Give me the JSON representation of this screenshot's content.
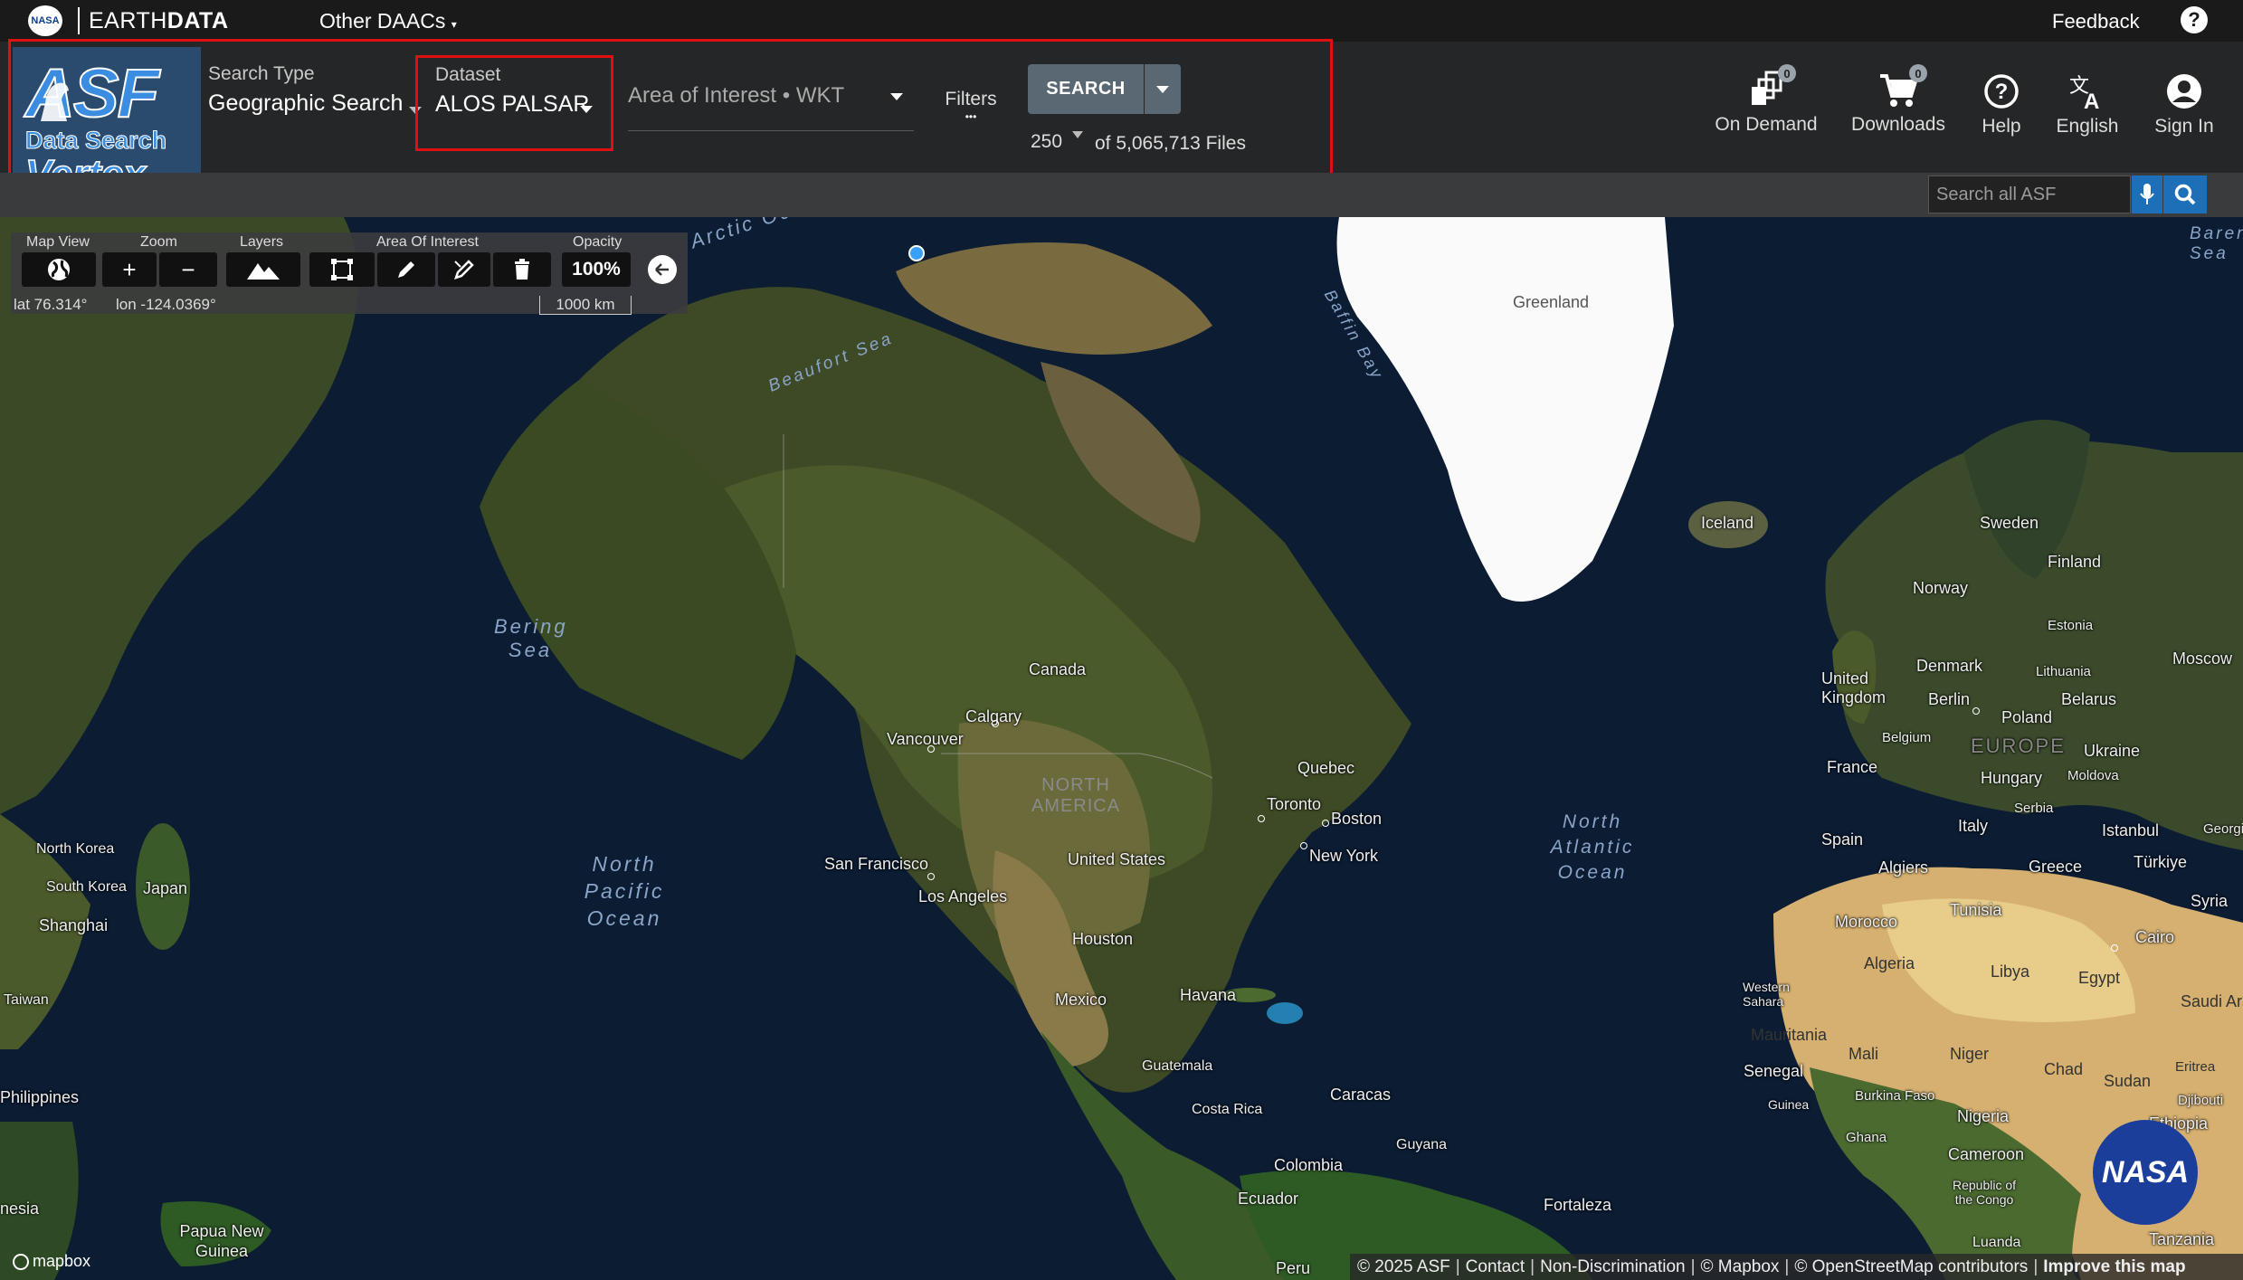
{
  "topbar": {
    "nasa_logo": "NASA",
    "brand": "EARTH",
    "brand_bold": "DATA",
    "other_daacs": "Other DAACs",
    "feedback": "Feedback",
    "help_icon": "?"
  },
  "logo": {
    "line1": "ASF",
    "line2": "Data Search",
    "line3": "Vertex"
  },
  "search": {
    "type_label": "Search Type",
    "type_value": "Geographic Search",
    "dataset_label": "Dataset",
    "dataset_value": "ALOS PALSAR",
    "aoi_placeholder": "Area of Interest • WKT",
    "filters_label": "Filters",
    "filters_dots": "•••",
    "search_button": "SEARCH",
    "max_results": "250",
    "file_count": "of 5,065,713 Files"
  },
  "header_right": {
    "on_demand": {
      "label": "On Demand",
      "badge": "0",
      "icon": "stack-icon"
    },
    "downloads": {
      "label": "Downloads",
      "badge": "0",
      "icon": "cart-icon"
    },
    "help": {
      "label": "Help",
      "icon": "help-circle-icon"
    },
    "language": {
      "label": "English",
      "icon": "translate-icon"
    },
    "sign_in": {
      "label": "Sign In",
      "icon": "account-icon"
    }
  },
  "site_search": {
    "placeholder": "Search all ASF"
  },
  "map_controls": {
    "labels": {
      "map_view": "Map View",
      "zoom": "Zoom",
      "layers": "Layers",
      "aoi": "Area Of Interest",
      "opacity": "Opacity"
    },
    "zoom_in": "+",
    "zoom_out": "−",
    "opacity_value": "100%",
    "lat": "lat 76.314°",
    "lon": "lon -124.0369°",
    "scale": "1000 km"
  },
  "map_labels": {
    "arctic": "Arctic Ocean",
    "greenland": "Greenland",
    "baffin": "Baffin Bay",
    "beaufort": "Beaufort Sea",
    "barents": "Barents Sea",
    "bering": "Bering Sea",
    "north_pacific": "North Pacific Ocean",
    "north_atlantic": "North Atlantic Ocean",
    "canada": "Canada",
    "iceland": "Iceland",
    "sweden": "Sweden",
    "finland": "Finland",
    "norway": "Norway",
    "estonia": "Estonia",
    "moscow": "Moscow",
    "denmark": "Denmark",
    "lithuania": "Lithuania",
    "uk": "United Kingdom",
    "berlin": "Berlin",
    "belarus": "Belarus",
    "poland": "Poland",
    "belgium": "Belgium",
    "ukraine": "Ukraine",
    "france": "France",
    "hungary": "Hungary",
    "moldova": "Moldova",
    "serbia": "Serbia",
    "italy": "Italy",
    "istanbul": "Istanbul",
    "georgia": "Georgia",
    "spain": "Spain",
    "greece": "Greece",
    "turkiye": "Türkiye",
    "algiers": "Algiers",
    "tunisia": "Tunisia",
    "syria": "Syria",
    "morocco": "Morocco",
    "cairo": "Cairo",
    "algeria": "Algeria",
    "libya": "Libya",
    "egypt": "Egypt",
    "saudi": "Saudi Ara",
    "western_sahara": "Western Sahara",
    "mauritania": "Mauritania",
    "mali": "Mali",
    "niger": "Niger",
    "chad": "Chad",
    "sudan": "Sudan",
    "eritrea": "Eritrea",
    "senegal": "Senegal",
    "guinea": "Guinea",
    "burkina": "Burkina Faso",
    "nigeria": "Nigeria",
    "ghana": "Ghana",
    "djibouti": "Djibouti",
    "ethiopia": "Ethiopia",
    "cameroon": "Cameroon",
    "congo": "Republic of the Congo",
    "tanzania": "Tanzania",
    "luanda": "Luanda",
    "calgary": "Calgary",
    "vancouver": "Vancouver",
    "quebec": "Quebec",
    "toronto": "Toronto",
    "boston": "Boston",
    "new_york": "New York",
    "north_america": "NORTH AMERICA",
    "united_states": "United States",
    "san_francisco": "San Francisco",
    "los_angeles": "Los Angeles",
    "houston": "Houston",
    "mexico": "Mexico",
    "havana": "Havana",
    "guatemala": "Guatemala",
    "costa_rica": "Costa Rica",
    "caracas": "Caracas",
    "guyana": "Guyana",
    "colombia": "Colombia",
    "ecuador": "Ecuador",
    "peru": "Peru",
    "fortaleza": "Fortaleza",
    "north_korea": "North Korea",
    "south_korea": "South Korea",
    "japan": "Japan",
    "shanghai": "Shanghai",
    "taiwan": "Taiwan",
    "philippines": "Philippines",
    "papua": "Papua New Guinea",
    "nesia": "nesia",
    "europe": "EUROPE"
  },
  "mapbox_logo": "mapbox",
  "nasa_badge": "NASA",
  "footer": {
    "copyright": "© 2025 ASF",
    "contact": "Contact",
    "non_discrimination": "Non-Discrimination",
    "mapbox": "© Mapbox",
    "osm": "© OpenStreetMap contributors",
    "improve": "Improve this map"
  },
  "colors": {
    "topbar": "#1a1a1a",
    "header": "#252627",
    "highlight": "#e01010",
    "accent": "#1d6fb8",
    "ocean": "#0b1c33"
  }
}
